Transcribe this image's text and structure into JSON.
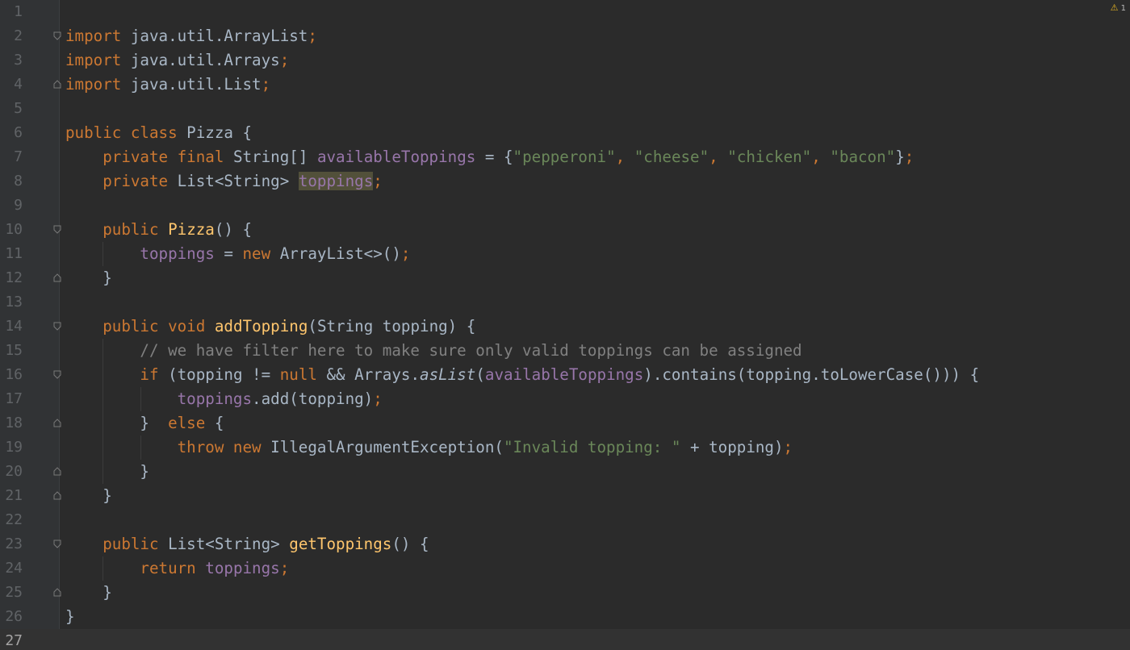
{
  "editor": {
    "warning_count": "1",
    "lines": [
      {
        "n": "1",
        "tokens": []
      },
      {
        "n": "2",
        "fold": "start",
        "tokens": [
          {
            "t": "import",
            "c": "kw"
          },
          {
            "t": " java.util.ArrayList",
            "c": "pl"
          },
          {
            "t": ";",
            "c": "kw"
          }
        ]
      },
      {
        "n": "3",
        "tokens": [
          {
            "t": "import",
            "c": "kw"
          },
          {
            "t": " java.util.Arrays",
            "c": "pl"
          },
          {
            "t": ";",
            "c": "kw"
          }
        ]
      },
      {
        "n": "4",
        "fold": "end",
        "tokens": [
          {
            "t": "import",
            "c": "kw"
          },
          {
            "t": " java.util.List",
            "c": "pl"
          },
          {
            "t": ";",
            "c": "kw"
          }
        ]
      },
      {
        "n": "5",
        "tokens": []
      },
      {
        "n": "6",
        "tokens": [
          {
            "t": "public class",
            "c": "kw"
          },
          {
            "t": " Pizza {",
            "c": "pl"
          }
        ]
      },
      {
        "n": "7",
        "tokens": [
          {
            "t": "    "
          },
          {
            "t": "private final",
            "c": "kw"
          },
          {
            "t": " String[] ",
            "c": "pl"
          },
          {
            "t": "availableToppings",
            "c": "fld"
          },
          {
            "t": " = {",
            "c": "pl"
          },
          {
            "t": "\"pepperoni\"",
            "c": "str"
          },
          {
            "t": ", ",
            "c": "kw"
          },
          {
            "t": "\"cheese\"",
            "c": "str"
          },
          {
            "t": ", ",
            "c": "kw"
          },
          {
            "t": "\"chicken\"",
            "c": "str"
          },
          {
            "t": ", ",
            "c": "kw"
          },
          {
            "t": "\"bacon\"",
            "c": "str"
          },
          {
            "t": "}",
            "c": "pl"
          },
          {
            "t": ";",
            "c": "kw"
          }
        ]
      },
      {
        "n": "8",
        "tokens": [
          {
            "t": "    "
          },
          {
            "t": "private",
            "c": "kw"
          },
          {
            "t": " List<String> ",
            "c": "pl"
          },
          {
            "t": "toppings",
            "c": "fld hl"
          },
          {
            "t": ";",
            "c": "kw"
          }
        ]
      },
      {
        "n": "9",
        "tokens": []
      },
      {
        "n": "10",
        "fold": "start",
        "tokens": [
          {
            "t": "    "
          },
          {
            "t": "public",
            "c": "kw"
          },
          {
            "t": " "
          },
          {
            "t": "Pizza",
            "c": "fn"
          },
          {
            "t": "() {",
            "c": "pl"
          }
        ]
      },
      {
        "n": "11",
        "tokens": [
          {
            "t": "        "
          },
          {
            "t": "toppings",
            "c": "fld"
          },
          {
            "t": " = ",
            "c": "pl"
          },
          {
            "t": "new",
            "c": "kw"
          },
          {
            "t": " ArrayList<>()",
            "c": "pl"
          },
          {
            "t": ";",
            "c": "kw"
          }
        ]
      },
      {
        "n": "12",
        "fold": "end",
        "tokens": [
          {
            "t": "    "
          },
          {
            "t": "}",
            "c": "pl"
          }
        ]
      },
      {
        "n": "13",
        "tokens": []
      },
      {
        "n": "14",
        "fold": "start",
        "tokens": [
          {
            "t": "    "
          },
          {
            "t": "public void",
            "c": "kw"
          },
          {
            "t": " "
          },
          {
            "t": "addTopping",
            "c": "fn"
          },
          {
            "t": "(String topping) {",
            "c": "pl"
          }
        ]
      },
      {
        "n": "15",
        "tokens": [
          {
            "t": "        "
          },
          {
            "t": "// we have filter here to make sure only valid toppings can be assigned",
            "c": "cmt"
          }
        ]
      },
      {
        "n": "16",
        "fold": "start",
        "tokens": [
          {
            "t": "        "
          },
          {
            "t": "if",
            "c": "kw"
          },
          {
            "t": " (topping != ",
            "c": "pl"
          },
          {
            "t": "null",
            "c": "kw"
          },
          {
            "t": " && Arrays.",
            "c": "pl"
          },
          {
            "t": "asList",
            "c": "pl ital"
          },
          {
            "t": "(",
            "c": "pl"
          },
          {
            "t": "availableToppings",
            "c": "fld"
          },
          {
            "t": ").contains(topping.toLowerCase())) {",
            "c": "pl"
          }
        ]
      },
      {
        "n": "17",
        "tokens": [
          {
            "t": "            "
          },
          {
            "t": "toppings",
            "c": "fld"
          },
          {
            "t": ".add(topping)",
            "c": "pl"
          },
          {
            "t": ";",
            "c": "kw"
          }
        ]
      },
      {
        "n": "18",
        "fold": "end",
        "tokens": [
          {
            "t": "        "
          },
          {
            "t": "}  ",
            "c": "pl"
          },
          {
            "t": "else",
            "c": "kw"
          },
          {
            "t": " {",
            "c": "pl"
          }
        ]
      },
      {
        "n": "19",
        "tokens": [
          {
            "t": "            "
          },
          {
            "t": "throw new",
            "c": "kw"
          },
          {
            "t": " IllegalArgumentException(",
            "c": "pl"
          },
          {
            "t": "\"Invalid topping: \"",
            "c": "str"
          },
          {
            "t": " + topping)",
            "c": "pl"
          },
          {
            "t": ";",
            "c": "kw"
          }
        ]
      },
      {
        "n": "20",
        "fold": "end",
        "tokens": [
          {
            "t": "        "
          },
          {
            "t": "}",
            "c": "pl"
          }
        ]
      },
      {
        "n": "21",
        "fold": "end",
        "tokens": [
          {
            "t": "    "
          },
          {
            "t": "}",
            "c": "pl"
          }
        ]
      },
      {
        "n": "22",
        "tokens": []
      },
      {
        "n": "23",
        "fold": "start",
        "tokens": [
          {
            "t": "    "
          },
          {
            "t": "public",
            "c": "kw"
          },
          {
            "t": " List<String> ",
            "c": "pl"
          },
          {
            "t": "getToppings",
            "c": "fn"
          },
          {
            "t": "() {",
            "c": "pl"
          }
        ]
      },
      {
        "n": "24",
        "tokens": [
          {
            "t": "        "
          },
          {
            "t": "return",
            "c": "kw"
          },
          {
            "t": " "
          },
          {
            "t": "toppings",
            "c": "fld"
          },
          {
            "t": ";",
            "c": "kw"
          }
        ]
      },
      {
        "n": "25",
        "fold": "end",
        "tokens": [
          {
            "t": "    "
          },
          {
            "t": "}",
            "c": "pl"
          }
        ]
      },
      {
        "n": "26",
        "tokens": [
          {
            "t": "}",
            "c": "pl"
          }
        ]
      },
      {
        "n": "27",
        "current": true,
        "tokens": []
      }
    ]
  }
}
